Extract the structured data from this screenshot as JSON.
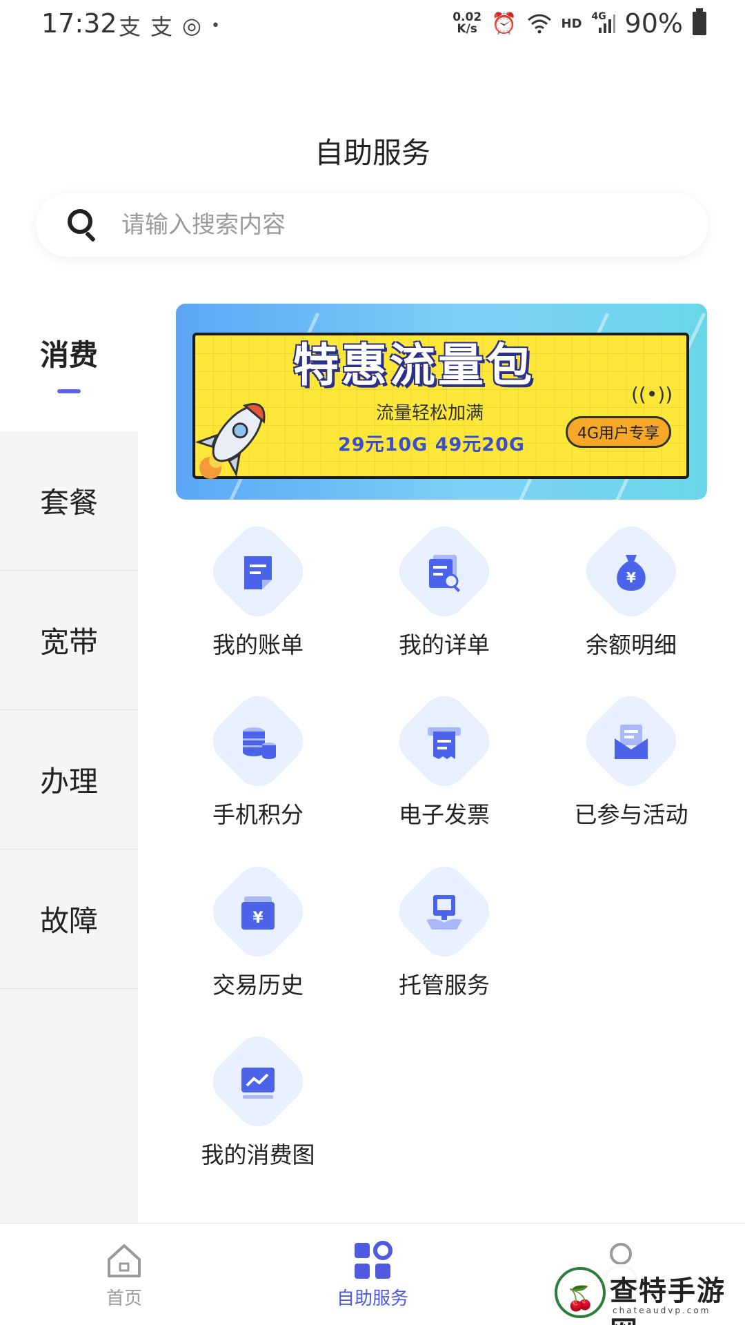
{
  "status_bar": {
    "time": "17:32",
    "left_icons": [
      "支",
      "支",
      "◎",
      "•"
    ],
    "net_speed_value": "0.02",
    "net_speed_unit": "K/s",
    "hd": "HD",
    "network": "4G",
    "battery": "90%"
  },
  "header": {
    "title": "自助服务"
  },
  "search": {
    "placeholder": "请输入搜索内容"
  },
  "side_nav": {
    "items": [
      {
        "label": "消费",
        "active": true
      },
      {
        "label": "套餐"
      },
      {
        "label": "宽带"
      },
      {
        "label": "办理"
      },
      {
        "label": "故障"
      }
    ]
  },
  "banner": {
    "title": "特惠流量包",
    "subtitle": "流量轻松加满",
    "price": "29元10G  49元20G",
    "badge": "4G用户专享"
  },
  "services": [
    {
      "label": "我的账单",
      "icon": "bill-icon"
    },
    {
      "label": "我的详单",
      "icon": "detail-list-icon"
    },
    {
      "label": "余额明细",
      "icon": "money-bag-icon"
    },
    {
      "label": "手机积分",
      "icon": "coins-icon"
    },
    {
      "label": "电子发票",
      "icon": "invoice-icon"
    },
    {
      "label": "已参与活动",
      "icon": "envelope-icon"
    },
    {
      "label": "交易历史",
      "icon": "transaction-icon"
    },
    {
      "label": "托管服务",
      "icon": "hosting-icon"
    },
    {
      "label": "我的消费图",
      "icon": "chart-monitor-icon"
    }
  ],
  "bottom_nav": {
    "tabs": [
      {
        "label": "首页",
        "icon": "home-icon",
        "active": false
      },
      {
        "label": "自助服务",
        "icon": "grid-icon",
        "active": true
      },
      {
        "label": "",
        "icon": "user-icon",
        "active": false
      }
    ]
  },
  "watermark": {
    "text": "查特手游网",
    "sub": "chateaudvp.com"
  },
  "colors": {
    "accent": "#4f5ae0",
    "tile_bg": "#e8efff",
    "icon_blue": "#4a63e8",
    "side_bg": "#f5f5f5"
  }
}
